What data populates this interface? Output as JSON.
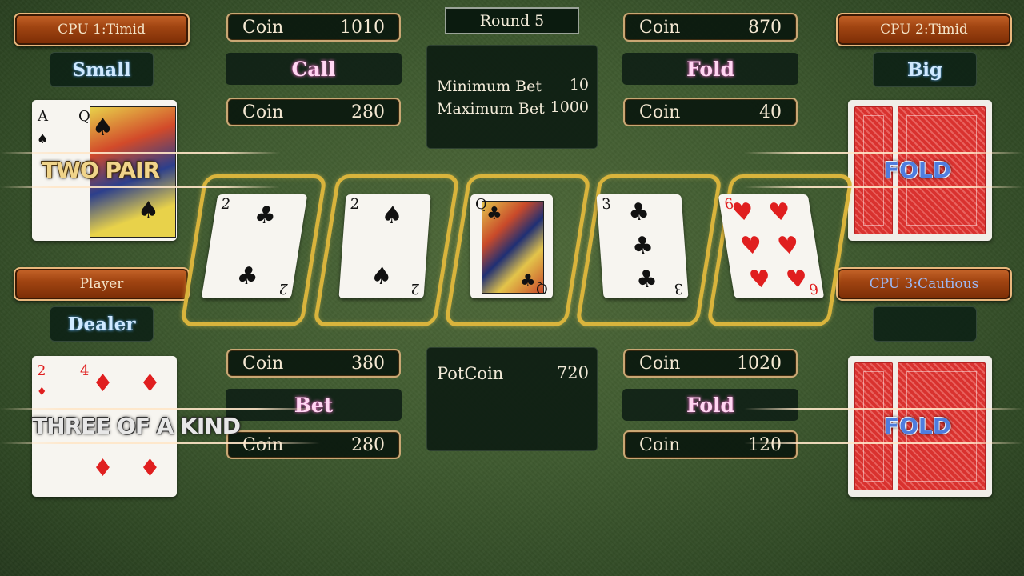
{
  "round": {
    "label": "Round 5"
  },
  "limits": {
    "min_label": "Minimum Bet",
    "min_value": "10",
    "max_label": "Maximum Bet",
    "max_value": "1000"
  },
  "pot": {
    "label": "PotCoin",
    "value": "720"
  },
  "players": {
    "cpu1": {
      "name": "CPU 1:Timid",
      "role": "Small",
      "coin_label": "Coin",
      "coin": "1010",
      "action": "Call",
      "bet_label": "Coin",
      "bet": "280",
      "hand": "TWO PAIR"
    },
    "cpu2": {
      "name": "CPU 2:Timid",
      "role": "Big",
      "coin_label": "Coin",
      "coin": "870",
      "action": "Fold",
      "bet_label": "Coin",
      "bet": "40",
      "hand": "FOLD"
    },
    "player": {
      "name": "Player",
      "role": "Dealer",
      "coin_label": "Coin",
      "coin": "380",
      "action": "Bet",
      "bet_label": "Coin",
      "bet": "280",
      "hand": "THREE OF A KIND"
    },
    "cpu3": {
      "name": "CPU 3:Cautious",
      "role": "",
      "coin_label": "Coin",
      "coin": "1020",
      "action": "Fold",
      "bet_label": "Coin",
      "bet": "120",
      "hand": "FOLD"
    }
  },
  "cards": {
    "cpu1_a": {
      "rank": "A",
      "suit": "♠",
      "color": "black"
    },
    "cpu1_b": {
      "rank": "Q",
      "suit": "♠",
      "color": "black"
    },
    "player_a": {
      "rank": "2",
      "suit": "♦",
      "color": "red"
    },
    "player_b": {
      "rank": "4",
      "suit": "♦",
      "color": "red"
    },
    "board": [
      {
        "rank": "2",
        "suit": "♣",
        "color": "black"
      },
      {
        "rank": "2",
        "suit": "♠",
        "color": "black"
      },
      {
        "rank": "Q",
        "suit": "♣",
        "color": "black"
      },
      {
        "rank": "3",
        "suit": "♣",
        "color": "black"
      },
      {
        "rank": "6",
        "suit": "♥",
        "color": "red"
      }
    ]
  },
  "colors": {
    "felt": "#3f5a30",
    "slot_gold": "#d9b43c",
    "plate_orange": "#a14512",
    "action_pink": "#ffd6f2",
    "role_blue": "#cfe9ff",
    "fold_blue": "#4f7dde",
    "hand_gold": "#f0d48a"
  }
}
